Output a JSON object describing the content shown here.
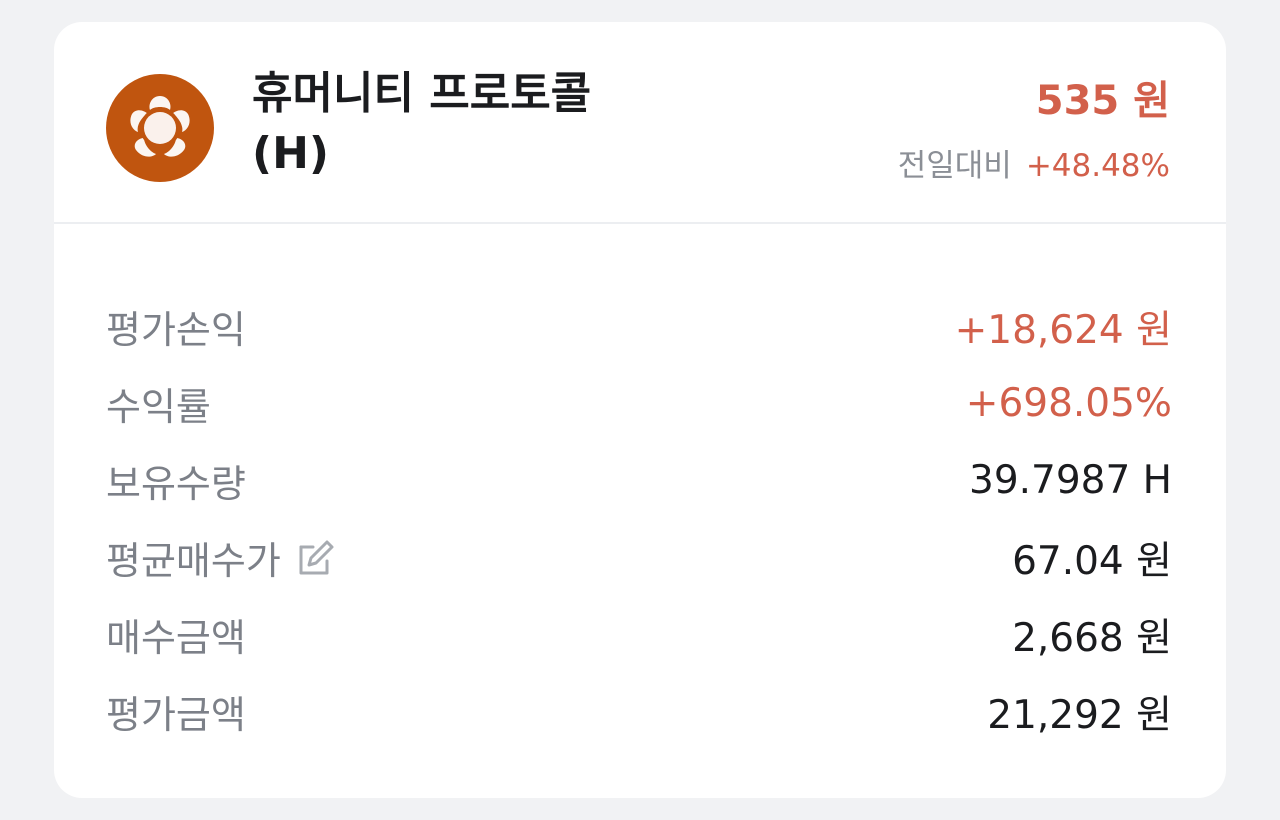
{
  "coin": {
    "name_line1": "휴머니티 프로토콜",
    "name_line2": "(H)",
    "logo_icon": "humanity-protocol-logo-icon",
    "logo_color": "#c0550f"
  },
  "price": {
    "current": "535 원",
    "change_label": "전일대비",
    "change_value": "+48.48%"
  },
  "colors": {
    "up": "#d2604b",
    "label": "#7c8088",
    "value": "#1b1c1f"
  },
  "details": {
    "pnl_label": "평가손익",
    "pnl_value": "+18,624 원",
    "return_label": "수익률",
    "return_value": "+698.05%",
    "holding_label": "보유수량",
    "holding_value": "39.7987 H",
    "avg_price_label": "평균매수가",
    "avg_price_value": "67.04 원",
    "avg_price_edit_icon": "edit-pencil-icon",
    "buy_amount_label": "매수금액",
    "buy_amount_value": "2,668 원",
    "eval_amount_label": "평가금액",
    "eval_amount_value": "21,292 원"
  }
}
